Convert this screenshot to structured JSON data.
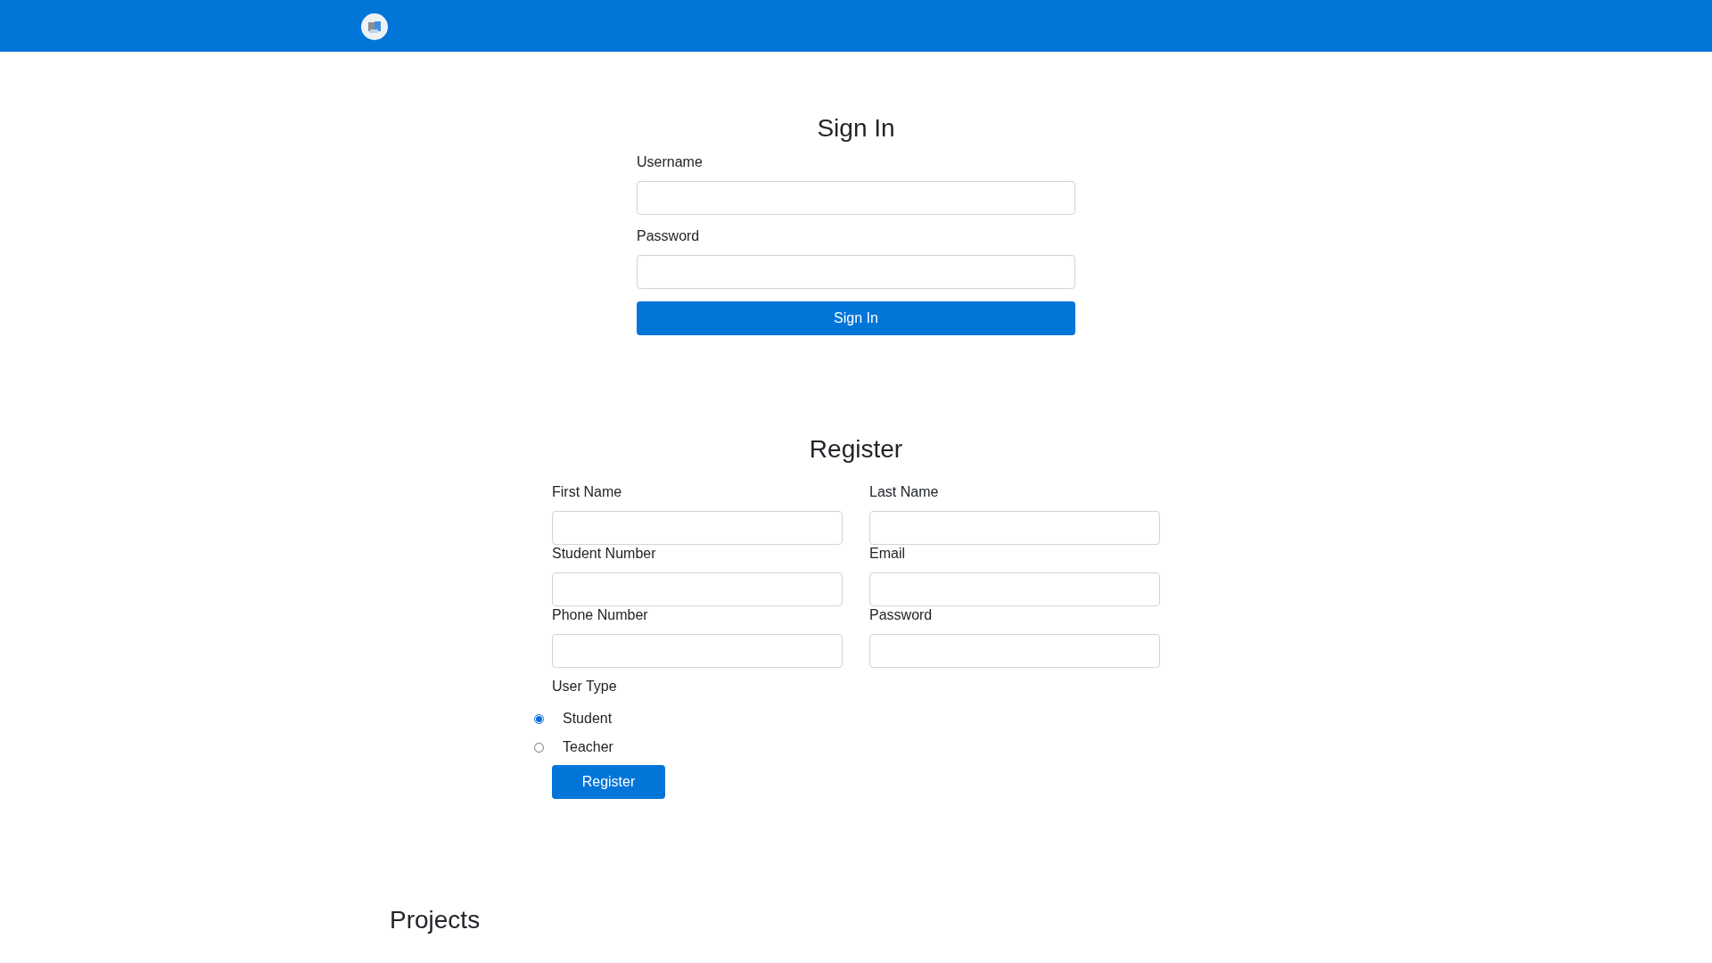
{
  "signin": {
    "title": "Sign In",
    "fields": [
      {
        "label": "Username"
      },
      {
        "label": "Password"
      }
    ],
    "button": "Sign In"
  },
  "register": {
    "title": "Register",
    "fields": [
      {
        "label": "First Name"
      },
      {
        "label": "Last Name"
      },
      {
        "label": "Student Number"
      },
      {
        "label": "Email"
      },
      {
        "label": "Phone Number"
      },
      {
        "label": "Password"
      }
    ],
    "user_type": {
      "label": "User Type",
      "options": [
        {
          "label": "Student",
          "selected": true
        },
        {
          "label": "Teacher",
          "selected": false
        }
      ]
    },
    "button": "Register"
  },
  "projects": {
    "title": "Projects"
  }
}
